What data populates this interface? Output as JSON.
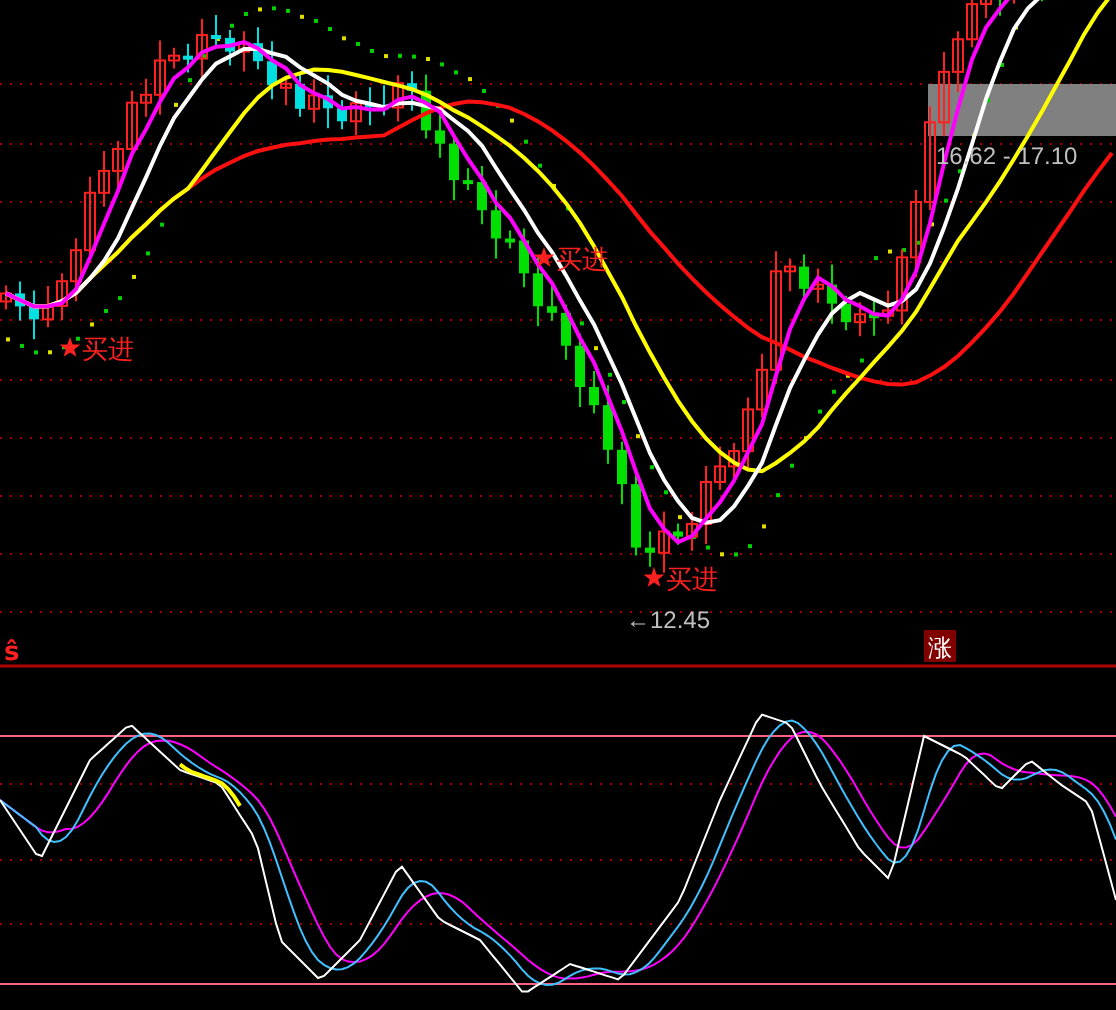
{
  "price_chart": {
    "buy_signals": [
      {
        "label": "买进"
      },
      {
        "label": "买进"
      },
      {
        "label": "买进"
      }
    ],
    "low_marker": "←12.45",
    "range_band": {
      "label": "16.62 - 17.10"
    }
  },
  "indicator_strip": {
    "marker": "ŝ",
    "badge": "涨"
  }
}
